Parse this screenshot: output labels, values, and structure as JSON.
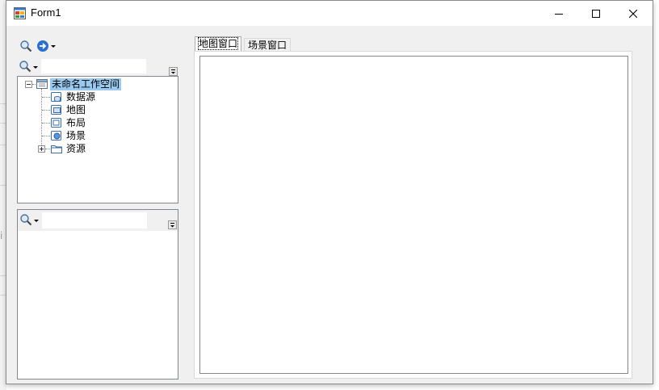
{
  "window": {
    "title": "Form1",
    "minimize_icon": "minimize-icon",
    "maximize_icon": "maximize-icon",
    "close_icon": "close-icon"
  },
  "workspace_panel": {
    "toolbar_icons": [
      "search-icon",
      "arrow-right-circle-icon"
    ],
    "search_dropdown_icon": "search-icon",
    "tree": {
      "root": {
        "label": "未命名工作空间",
        "icon": "workspace-icon",
        "expanded": true,
        "selected": true
      },
      "children": [
        {
          "label": "数据源",
          "icon": "datasource-icon"
        },
        {
          "label": "地图",
          "icon": "map-icon"
        },
        {
          "label": "布局",
          "icon": "layout-icon"
        },
        {
          "label": "场景",
          "icon": "scene-icon"
        },
        {
          "label": "资源",
          "icon": "folder-icon",
          "expandable": true
        }
      ]
    }
  },
  "layer_panel": {
    "search_dropdown_icon": "search-icon"
  },
  "tabs": [
    {
      "label": "地图窗口",
      "active": true
    },
    {
      "label": "场景窗口",
      "active": false
    }
  ],
  "background_fragment": "i"
}
